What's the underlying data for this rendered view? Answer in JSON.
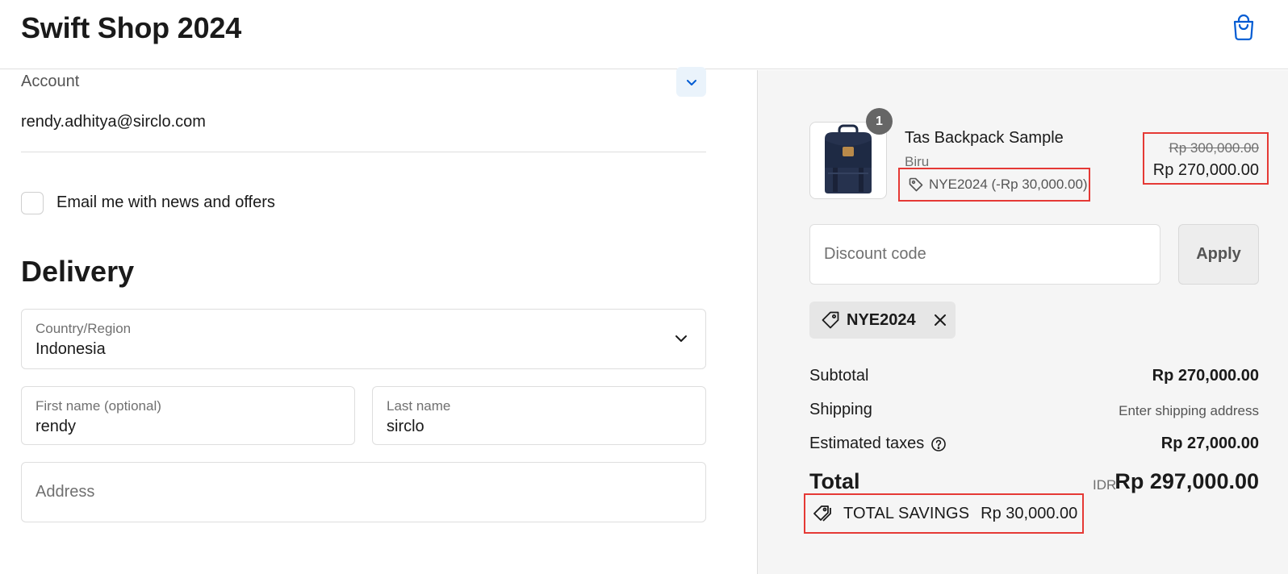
{
  "header": {
    "title": "Swift Shop 2024",
    "cart_icon": "shopping-bag-icon"
  },
  "account": {
    "label": "Account",
    "email": "rendy.adhitya@sirclo.com",
    "toggle_icon": "chevron-down-icon"
  },
  "newsletter": {
    "label": "Email me with news and offers",
    "checked": false
  },
  "delivery": {
    "title": "Delivery",
    "country": {
      "label": "Country/Region",
      "value": "Indonesia"
    },
    "first_name": {
      "label": "First name (optional)",
      "value": "rendy"
    },
    "last_name": {
      "label": "Last name",
      "value": "sirclo"
    },
    "address": {
      "placeholder": "Address"
    }
  },
  "order": {
    "item": {
      "quantity": "1",
      "name": "Tas Backpack Sample",
      "variant": "Biru",
      "discount": "NYE2024 (-Rp 30,000.00)",
      "original_price": "Rp 300,000.00",
      "price": "Rp 270,000.00"
    },
    "discount_input": {
      "placeholder": "Discount code"
    },
    "apply_label": "Apply",
    "applied_code": "NYE2024",
    "summary": {
      "subtotal_label": "Subtotal",
      "subtotal_value": "Rp 270,000.00",
      "shipping_label": "Shipping",
      "shipping_value": "Enter shipping address",
      "taxes_label": "Estimated taxes",
      "taxes_value": "Rp 27,000.00",
      "total_label": "Total",
      "total_currency": "IDR",
      "total_value": "Rp 297,000.00",
      "savings_label": "TOTAL SAVINGS",
      "savings_value": "Rp 30,000.00"
    }
  },
  "colors": {
    "accent": "#005bd3",
    "highlight": "#e53935",
    "summary_bg": "#f5f5f5"
  }
}
